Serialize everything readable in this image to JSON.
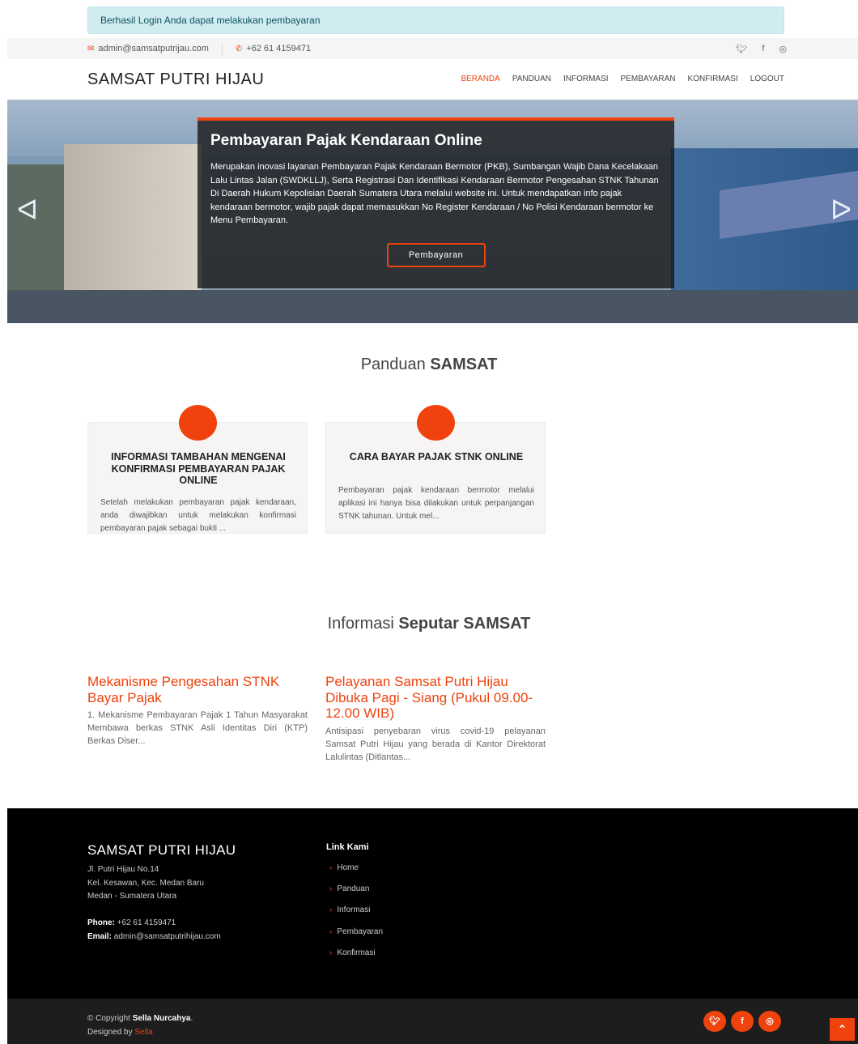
{
  "alert": "Berhasil Login Anda dapat melakukan pembayaran",
  "topbar": {
    "email": "admin@samsatputrijau.com",
    "phone": "+62 61 4159471",
    "social_icons": [
      "twitter-icon",
      "facebook-icon",
      "instagram-icon"
    ]
  },
  "header": {
    "logo": "SAMSAT PUTRI HIJAU",
    "nav": [
      {
        "label": "BERANDA",
        "active": true
      },
      {
        "label": "PANDUAN",
        "active": false
      },
      {
        "label": "INFORMASI",
        "active": false
      },
      {
        "label": "PEMBAYARAN",
        "active": false
      },
      {
        "label": "KONFIRMASI",
        "active": false
      },
      {
        "label": "LOGOUT",
        "active": false
      }
    ]
  },
  "hero": {
    "title": "Pembayaran Pajak Kendaraan Online",
    "text": "Merupakan inovasi layanan Pembayaran Pajak Kendaraan Bermotor (PKB), Sumbangan Wajib Dana Kecelakaan Lalu Lintas Jalan (SWDKLLJ), Serta Registrasi Dan Identifikasi Kendaraan Bermotor Pengesahan STNK Tahunan Di Daerah Hukum Kepolisian Daerah Sumatera Utara melalui website ini. Untuk mendapatkan info pajak kendaraan bermotor, wajib pajak dapat memasukkan No Register Kendaraan / No Polisi Kendaraan bermotor ke Menu Pembayaran.",
    "button": "Pembayaran",
    "prev": "ᐊ",
    "next": "ᐅ"
  },
  "panduan": {
    "title_plain": "Panduan ",
    "title_bold": "SAMSAT",
    "cards": [
      {
        "title": "INFORMASI TAMBAHAN MENGENAI KONFIRMASI PEMBAYARAN PAJAK ONLINE",
        "text": "Setelah melakukan pembayaran pajak kendaraan, anda diwajibkan untuk melakukan konfirmasi pembayaran pajak sebagai bukti ..."
      },
      {
        "title": "CARA BAYAR PAJAK STNK ONLINE",
        "text": "Pembayaran pajak kendaraan bermotor melalui aplikasi ini hanya bisa dilakukan untuk perpanjangan STNK tahunan. Untuk mel..."
      }
    ]
  },
  "informasi": {
    "title_plain": "Informasi ",
    "title_bold": "Seputar SAMSAT",
    "posts": [
      {
        "title": "Mekanisme Pengesahan STNK Bayar Pajak",
        "text": "1. Mekanisme Pembayaran Pajak 1 Tahun Masyarakat Membawa berkas STNK Asli Identitas Diri (KTP) Berkas Diser..."
      },
      {
        "title": "Pelayanan Samsat Putri Hijau Dibuka Pagi - Siang (Pukul 09.00-12.00 WIB)",
        "text": "Antisipasi penyebaran virus covid-19 pelayanan Samsat Putri Hijau yang berada di Kantor Direktorat Lalulintas (Ditlantas..."
      }
    ]
  },
  "footer": {
    "brand": "SAMSAT PUTRI HIJAU",
    "address": [
      "Jl. Putri Hijau No.14",
      "Kel. Kesawan, Kec. Medan Baru",
      "Medan - Sumatera Utara"
    ],
    "phone_label": "Phone:",
    "phone": " +62 61 4159471",
    "email_label": "Email:",
    "email": " admin@samsatputrihijau.com",
    "links_title": "Link Kami",
    "links": [
      "Home",
      "Panduan",
      "Informasi",
      "Pembayaran",
      "Konfirmasi"
    ]
  },
  "bottom": {
    "copyright_prefix": "© Copyright ",
    "copyright_name": "Sella Nurcahya",
    "copyright_suffix": ".",
    "designed_prefix": "Designed by ",
    "designed_name": "Sella"
  },
  "colors": {
    "accent": "#f0420d",
    "alert_bg": "#d1ecf1",
    "footer_bg": "#000000"
  }
}
